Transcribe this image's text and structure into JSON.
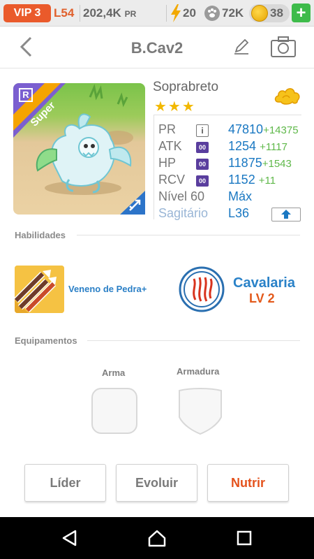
{
  "status": {
    "vip": "VIP 3",
    "level": "L54",
    "power": "202,4K",
    "power_unit": "PR",
    "energy": "20",
    "food": "72K",
    "gold": "38",
    "add": "+"
  },
  "header": {
    "title": "B.Cav2"
  },
  "dragon": {
    "rarity_badge": "R",
    "grade": "Super",
    "name": "Soprabreto",
    "stars": "★★★",
    "stats": [
      {
        "label": "PR",
        "value": "47810",
        "bonus": "+14375",
        "badge": "i"
      },
      {
        "label": "ATK",
        "value": "1254",
        "bonus": "+1117",
        "badge": "00"
      },
      {
        "label": "HP",
        "value": "11875",
        "bonus": "+1543",
        "badge": "00"
      },
      {
        "label": "RCV",
        "value": "1152",
        "bonus": "+11",
        "badge": "00"
      }
    ],
    "level_label": "Nível 60",
    "level_value": "Máx",
    "sign_label": "Sagitário",
    "sign_value": "L36"
  },
  "skills": {
    "section_label": "Habilidades",
    "active_name": "Veneno de Pedra+",
    "class_name": "Cavalaria",
    "class_level": "LV 2"
  },
  "equipment": {
    "section_label": "Equipamentos",
    "weapon_label": "Arma",
    "armor_label": "Armadura"
  },
  "actions": {
    "leader": "Líder",
    "evolve": "Evoluir",
    "feed": "Nutrir"
  },
  "colors": {
    "accent_orange": "#e4521c",
    "stat_blue": "#1a78c2",
    "bonus_green": "#5fb84a",
    "vip_red": "#ea5a2b"
  }
}
